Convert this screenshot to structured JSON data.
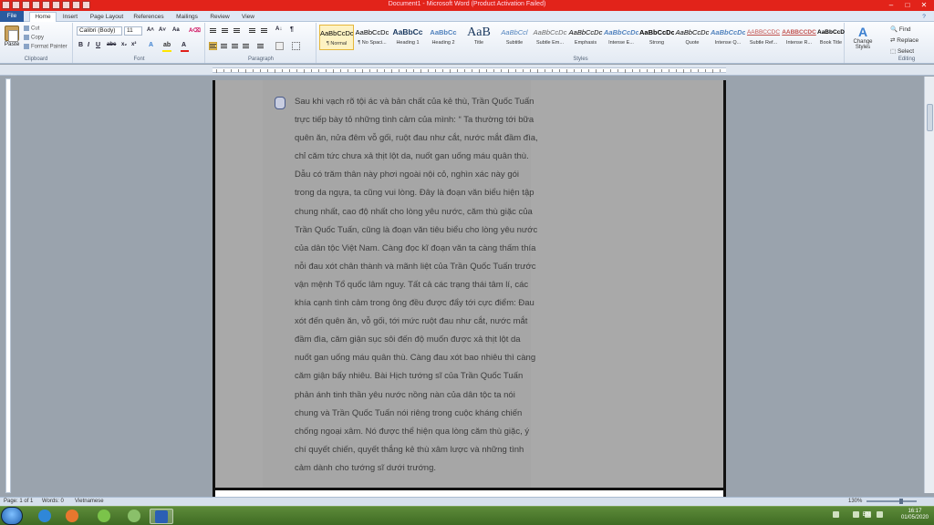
{
  "window": {
    "title": "Document1 - Microsoft Word (Product Activation Failed)"
  },
  "tabs": [
    "File",
    "Home",
    "Insert",
    "Page Layout",
    "References",
    "Mailings",
    "Review",
    "View"
  ],
  "clipboard": {
    "paste": "Paste",
    "cut": "Cut",
    "copy": "Copy",
    "format_painter": "Format Painter",
    "label": "Clipboard"
  },
  "font": {
    "name": "Calibri (Body)",
    "size": "11",
    "label": "Font"
  },
  "paragraph": {
    "label": "Paragraph"
  },
  "styles": {
    "label": "Styles",
    "items": [
      {
        "preview": "AaBbCcDc",
        "name": "¶ Normal"
      },
      {
        "preview": "AaBbCcDc",
        "name": "¶ No Spaci..."
      },
      {
        "preview": "AaBbCc",
        "name": "Heading 1"
      },
      {
        "preview": "AaBbCc",
        "name": "Heading 2"
      },
      {
        "preview": "AaB",
        "name": "Title"
      },
      {
        "preview": "AaBbCcl",
        "name": "Subtitle"
      },
      {
        "preview": "AaBbCcDc",
        "name": "Subtle Em..."
      },
      {
        "preview": "AaBbCcDc",
        "name": "Emphasis"
      },
      {
        "preview": "AaBbCcDc",
        "name": "Intense E..."
      },
      {
        "preview": "AaBbCcDc",
        "name": "Strong"
      },
      {
        "preview": "AaBbCcDc",
        "name": "Quote"
      },
      {
        "preview": "AaBbCcDc",
        "name": "Intense Q..."
      },
      {
        "preview": "AABBCCDC",
        "name": "Subtle Ref..."
      },
      {
        "preview": "AABBCCDC",
        "name": "Intense R..."
      },
      {
        "preview": "AaBbCcDc",
        "name": "Book Title"
      }
    ],
    "change": "Change Styles"
  },
  "editing": {
    "find": "Find",
    "replace": "Replace",
    "select": "Select",
    "label": "Editing"
  },
  "document": {
    "lines": [
      "Sau khi vạch rõ tội ác và bản chất của kẻ thù, Trần Quốc Tuấn",
      "trực tiếp bày tỏ những tình cảm của mình: “ Ta thường tới bữa",
      "quên ăn, nửa đêm vỗ gối, ruột đau như cắt, nước mắt đầm đìa,",
      "chỉ căm tức chưa xả thịt lột da, nuốt gan uống máu quân thù.",
      "Dẫu có trăm thân này phơi ngoài nội cỏ, nghìn xác này gói",
      "trong da ngựa, ta cũng vui lòng. Đây là đoạn văn biểu hiện tập",
      "chung nhất, cao độ nhất cho lòng yêu nước, căm thù giặc của",
      "Trần Quốc Tuấn, cũng là đoạn văn tiêu biểu cho lòng yêu nước",
      "của dân tộc Việt Nam. Càng đọc kĩ đoạn văn ta càng thấm thía",
      "nỗi đau xót chân thành và mãnh liệt của Trần Quốc Tuấn trước",
      "vận mệnh Tổ quốc lâm nguy. Tất cả các trạng thái tâm lí, các",
      "khía cạnh tình cảm trong ông đều được đẩy tới cực điểm: Đau",
      "xót đến quên ăn, vỗ gối, tới mức ruột đau như cắt, nước mắt",
      "đầm đìa, căm giận sục sôi đến độ muốn được xả thịt lột da",
      "nuốt gan uống máu quân thù. Càng đau xót bao nhiêu thì càng",
      "căm giận bấy nhiêu. Bài Hịch tướng sĩ của Trần Quốc Tuấn",
      "phản ánh tinh thần yêu nước nồng nàn của dân tộc ta nói",
      "chung và Trần Quốc Tuấn nói riêng trong cuộc kháng chiến",
      "chống ngoại xâm. Nó được thể hiện qua lòng căm thù giặc, ý",
      "chí quyết chiến, quyết thắng kẻ thù xâm lược và những tình",
      "cảm dành cho tướng sĩ dưới trướng."
    ]
  },
  "status": {
    "page": "Page: 1 of 1",
    "words": "Words: 0",
    "lang": "Vietnamese",
    "zoom": "130%"
  },
  "tray": {
    "lang": "EN",
    "time": "16:17",
    "date": "01/05/2020"
  }
}
